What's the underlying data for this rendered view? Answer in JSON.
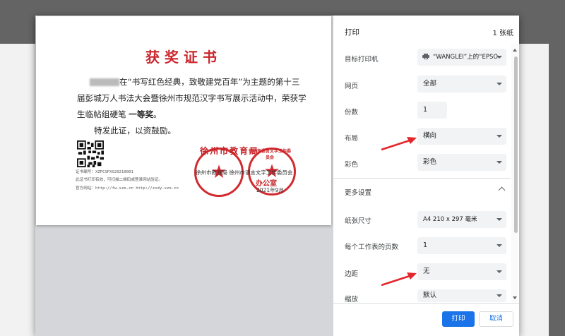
{
  "certificate": {
    "title": "获奖证书",
    "line1": "在“书写红色经典，致敬建党百年”为主题的第十三",
    "line2": "届彭城万人书法大会暨徐州市规范汉字书写展示活动中，荣获学",
    "line3_prefix": "生临帖组硬笔 ",
    "line3_award": "一等奖",
    "line3_suffix": "。",
    "line4": "特发此证，以资鼓励。",
    "cert_number": "证书编号：XZPCSFXS20210001",
    "verify_note": "此证书打印有效，可扫描二维码或登录网站验证。",
    "website": "官方网站：http://fw.xze.cn    http://zsdy.xze.cn",
    "stamp1_text": "徐州市教育局",
    "stamp2_text": "徐州市语言文字工作委员会",
    "stamp2_bottom": "办公室",
    "overlay_org": "徐州市教育局 徐州市语言文字工作委员会",
    "date": "2021年9月"
  },
  "panel": {
    "title": "打印",
    "sheet_count": "1 张纸",
    "rows": {
      "printer": {
        "label": "目标打印机",
        "value": "“WANGLEI”上的“EPSO"
      },
      "pages": {
        "label": "网页",
        "value": "全部"
      },
      "copies": {
        "label": "份数",
        "value": "1"
      },
      "layout": {
        "label": "布局",
        "value": "横向"
      },
      "color": {
        "label": "彩色",
        "value": "彩色"
      },
      "more": {
        "label": "更多设置"
      },
      "paper": {
        "label": "纸张尺寸",
        "value": "A4 210 x 297 毫米"
      },
      "pages_per_sheet": {
        "label": "每个工作表的页数",
        "value": "1"
      },
      "margins": {
        "label": "边距",
        "value": "无"
      },
      "scale": {
        "label": "缩放",
        "value": "默认"
      }
    },
    "print_button": "打印",
    "cancel_button": "取消"
  },
  "colors": {
    "accent": "#1a73e8",
    "seal": "#d12a2f",
    "annotation_arrow": "#e4262b"
  },
  "icons": [
    "printer-icon",
    "dropdown-caret-icon",
    "chevron-up-icon",
    "arrow-annotation-icon",
    "qr-code-icon",
    "star-icon"
  ]
}
